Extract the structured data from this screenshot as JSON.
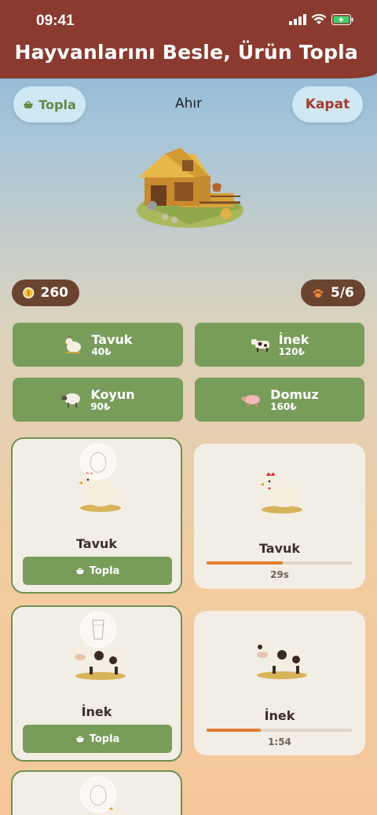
{
  "status": {
    "time": "09:41"
  },
  "header": {
    "title": "Hayvanlarını Besle, Ürün Topla"
  },
  "toolbar": {
    "collect_label": "Topla",
    "close_label": "Kapat",
    "location_label": "Ahır"
  },
  "stats": {
    "coins": "260",
    "capacity": "5/6"
  },
  "shop": [
    {
      "name": "Tavuk",
      "price": "40₺",
      "icon": "chicken-icon"
    },
    {
      "name": "İnek",
      "price": "120₺",
      "icon": "cow-icon"
    },
    {
      "name": "Koyun",
      "price": "90₺",
      "icon": "sheep-icon"
    },
    {
      "name": "Domuz",
      "price": "160₺",
      "icon": "pig-icon"
    }
  ],
  "animals": [
    {
      "name": "Tavuk",
      "state": "ready",
      "product_icon": "egg-icon",
      "action_label": "Topla"
    },
    {
      "name": "Tavuk",
      "state": "growing",
      "timer": "29s",
      "progress": 0.52
    },
    {
      "name": "İnek",
      "state": "ready",
      "product_icon": "milk-icon",
      "action_label": "Topla"
    },
    {
      "name": "İnek",
      "state": "growing",
      "timer": "1:54",
      "progress": 0.37
    },
    {
      "name": "",
      "state": "ready",
      "product_icon": "egg-icon"
    }
  ],
  "colors": {
    "header": "#8b3a2f",
    "green": "#789c5a",
    "chip": "#6b4430",
    "progress": "#e07d2e"
  }
}
